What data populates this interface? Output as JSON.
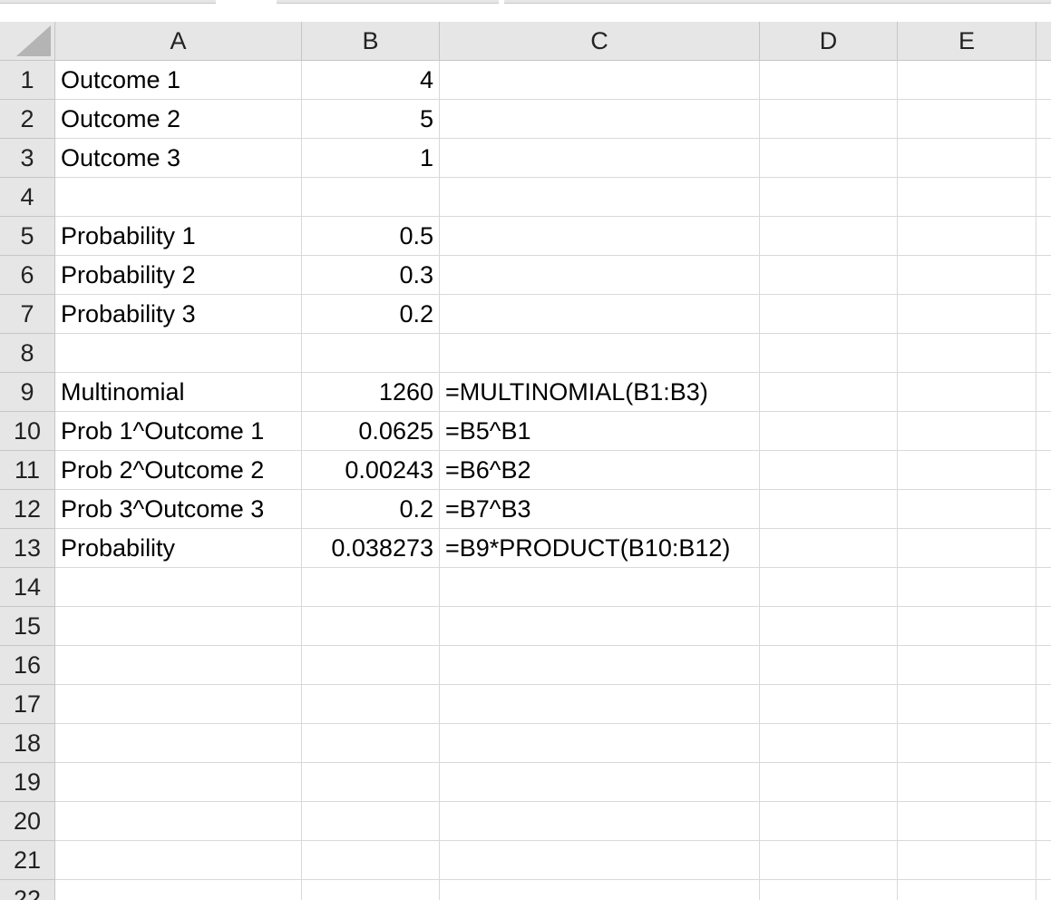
{
  "columns": [
    "A",
    "B",
    "C",
    "D",
    "E"
  ],
  "rows": [
    {
      "n": "1",
      "a": "Outcome 1",
      "b": "4",
      "c": ""
    },
    {
      "n": "2",
      "a": "Outcome 2",
      "b": "5",
      "c": ""
    },
    {
      "n": "3",
      "a": "Outcome 3",
      "b": "1",
      "c": ""
    },
    {
      "n": "4",
      "a": "",
      "b": "",
      "c": ""
    },
    {
      "n": "5",
      "a": "Probability 1",
      "b": "0.5",
      "c": ""
    },
    {
      "n": "6",
      "a": "Probability 2",
      "b": "0.3",
      "c": ""
    },
    {
      "n": "7",
      "a": "Probability 3",
      "b": "0.2",
      "c": ""
    },
    {
      "n": "8",
      "a": "",
      "b": "",
      "c": ""
    },
    {
      "n": "9",
      "a": "Multinomial",
      "b": "1260",
      "c": "=MULTINOMIAL(B1:B3)"
    },
    {
      "n": "10",
      "a": "Prob 1^Outcome 1",
      "b": "0.0625",
      "c": "=B5^B1"
    },
    {
      "n": "11",
      "a": "Prob 2^Outcome 2",
      "b": "0.00243",
      "c": "=B6^B2"
    },
    {
      "n": "12",
      "a": "Prob 3^Outcome 3",
      "b": "0.2",
      "c": "=B7^B3"
    },
    {
      "n": "13",
      "a": "Probability",
      "b": "0.038273",
      "c": "=B9*PRODUCT(B10:B12)"
    },
    {
      "n": "14",
      "a": "",
      "b": "",
      "c": ""
    },
    {
      "n": "15",
      "a": "",
      "b": "",
      "c": ""
    },
    {
      "n": "16",
      "a": "",
      "b": "",
      "c": ""
    },
    {
      "n": "17",
      "a": "",
      "b": "",
      "c": ""
    },
    {
      "n": "18",
      "a": "",
      "b": "",
      "c": ""
    },
    {
      "n": "19",
      "a": "",
      "b": "",
      "c": ""
    },
    {
      "n": "20",
      "a": "",
      "b": "",
      "c": ""
    },
    {
      "n": "21",
      "a": "",
      "b": "",
      "c": ""
    },
    {
      "n": "22",
      "a": "",
      "b": "",
      "c": ""
    }
  ],
  "colors": {
    "header_bg": "#e6e6e6",
    "gridline": "#d9d9d9",
    "header_border": "#c6c6c6"
  }
}
